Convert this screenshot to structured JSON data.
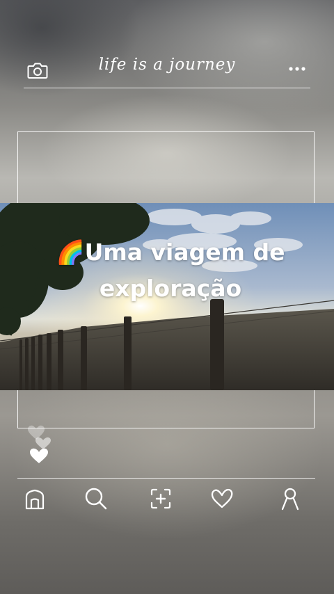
{
  "header": {
    "title": "life is a journey",
    "left_icon": "camera-icon",
    "right_icon": "more-dots-icon"
  },
  "post": {
    "emoji": "🌈",
    "caption": "Uma viagem de exploração"
  },
  "nav": {
    "items": [
      {
        "icon": "home-icon"
      },
      {
        "icon": "search-icon"
      },
      {
        "icon": "add-post-icon"
      },
      {
        "icon": "heart-icon"
      },
      {
        "icon": "profile-icon"
      }
    ]
  },
  "colors": {
    "line": "#ffffff",
    "sky": "#8aa6c8",
    "sun": "#fff7d6"
  }
}
